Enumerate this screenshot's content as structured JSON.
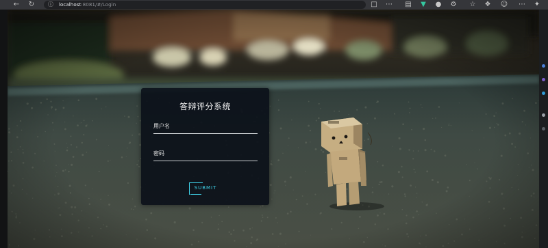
{
  "browser": {
    "url_host": "localhost",
    "url_rest": ":8081/#/Login",
    "toolbar_icons": [
      "back-icon",
      "reload-icon",
      "site-info-icon",
      "extension-icon",
      "share-icon",
      "reader-icon",
      "favorite-icon",
      "collections-icon",
      "profile-icon",
      "more-icon"
    ]
  },
  "login": {
    "title": "答辩评分系统",
    "username_label": "用户名",
    "password_label": "密码",
    "submit_label": "SUBMIT"
  },
  "colors": {
    "card_bg": "#0a1018",
    "accent": "#3fd0e6",
    "underline": "#cfd3d6"
  }
}
